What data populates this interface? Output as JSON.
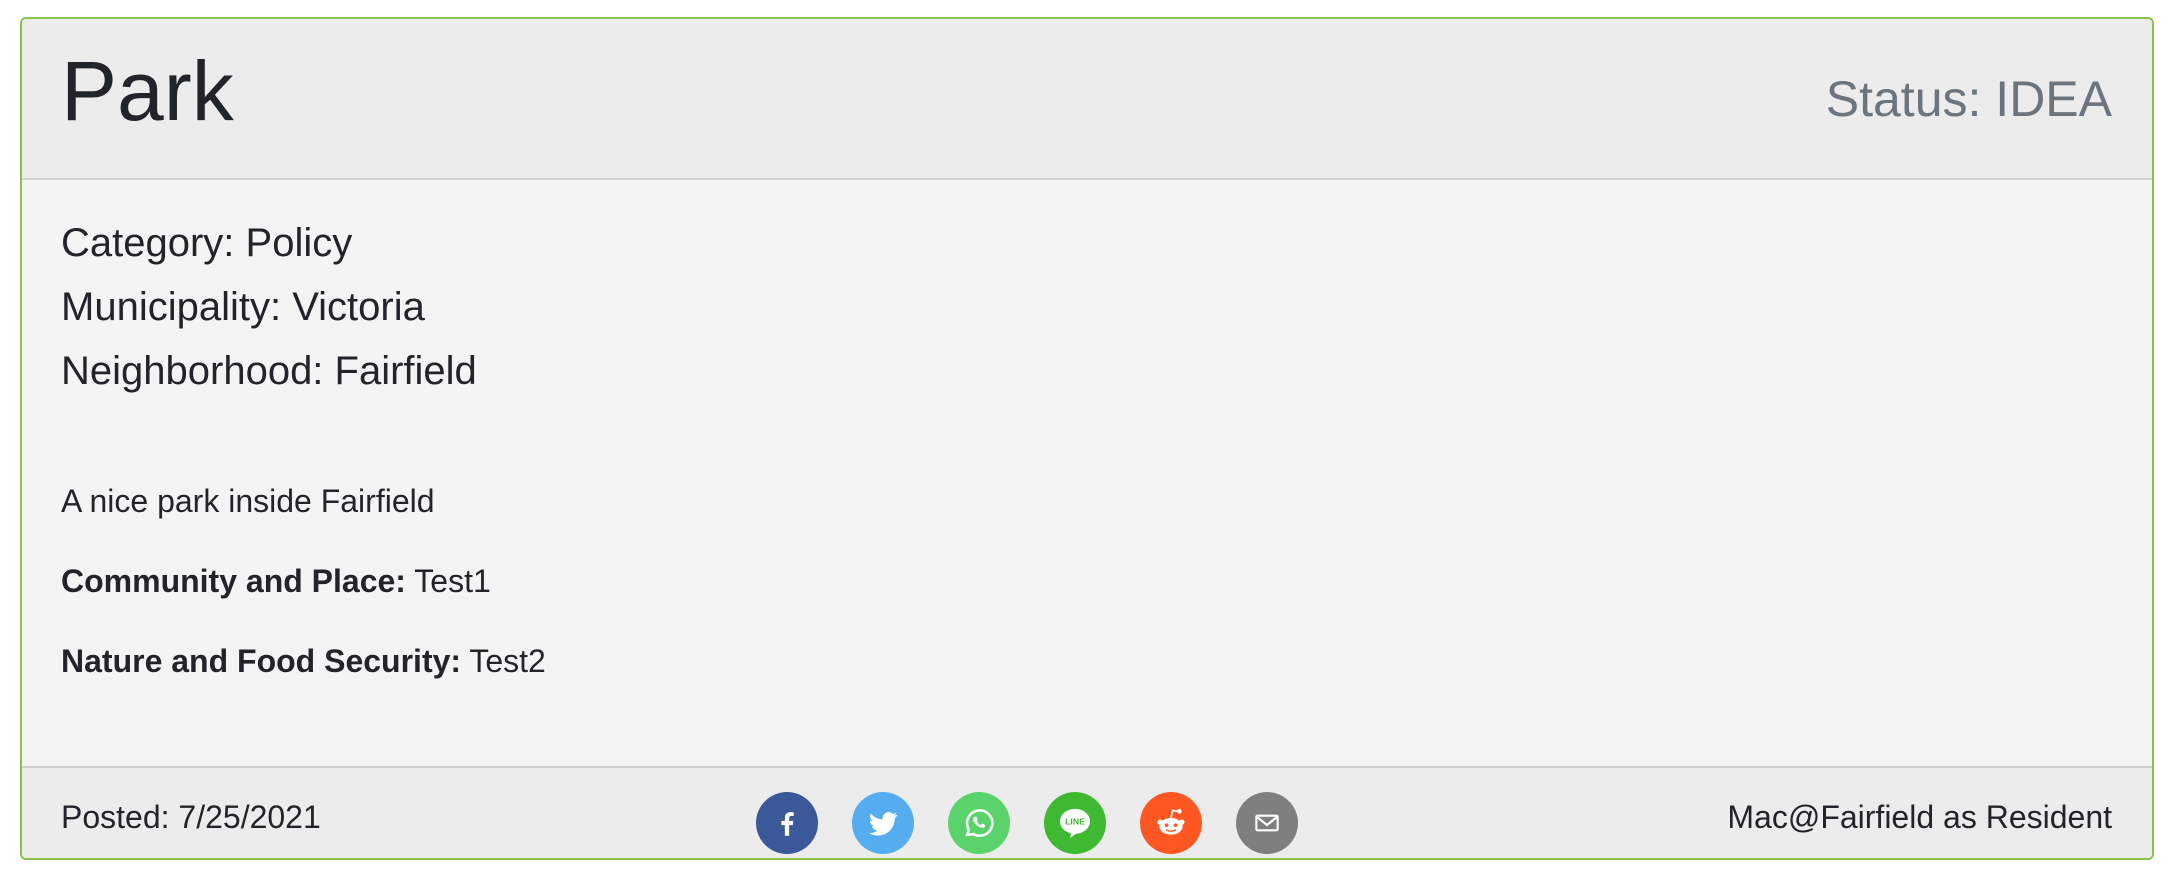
{
  "header": {
    "title": "Park",
    "status_label": "Status:",
    "status_value": "IDEA"
  },
  "meta": {
    "category": "Category: Policy",
    "municipality": "Municipality: Victoria",
    "neighborhood": "Neighborhood: Fairfield"
  },
  "body": {
    "description": "A nice park inside Fairfield",
    "fields": [
      {
        "label": "Community and Place:",
        "value": "Test1"
      },
      {
        "label": "Nature and Food Security:",
        "value": "Test2"
      }
    ]
  },
  "footer": {
    "posted": "Posted: 7/25/2021",
    "author": "Mac@Fairfield as Resident",
    "share_buttons": [
      {
        "icon": "facebook-icon",
        "color": "#3b5998"
      },
      {
        "icon": "twitter-icon",
        "color": "#55acee"
      },
      {
        "icon": "whatsapp-icon",
        "color": "#5ad46a"
      },
      {
        "icon": "line-icon",
        "color": "#3fb931"
      },
      {
        "icon": "reddit-icon",
        "color": "#ff5722"
      },
      {
        "icon": "email-icon",
        "color": "#7f7f7f"
      }
    ]
  },
  "colors": {
    "card_border": "#8bc34a",
    "status_text": "#6c757d"
  }
}
